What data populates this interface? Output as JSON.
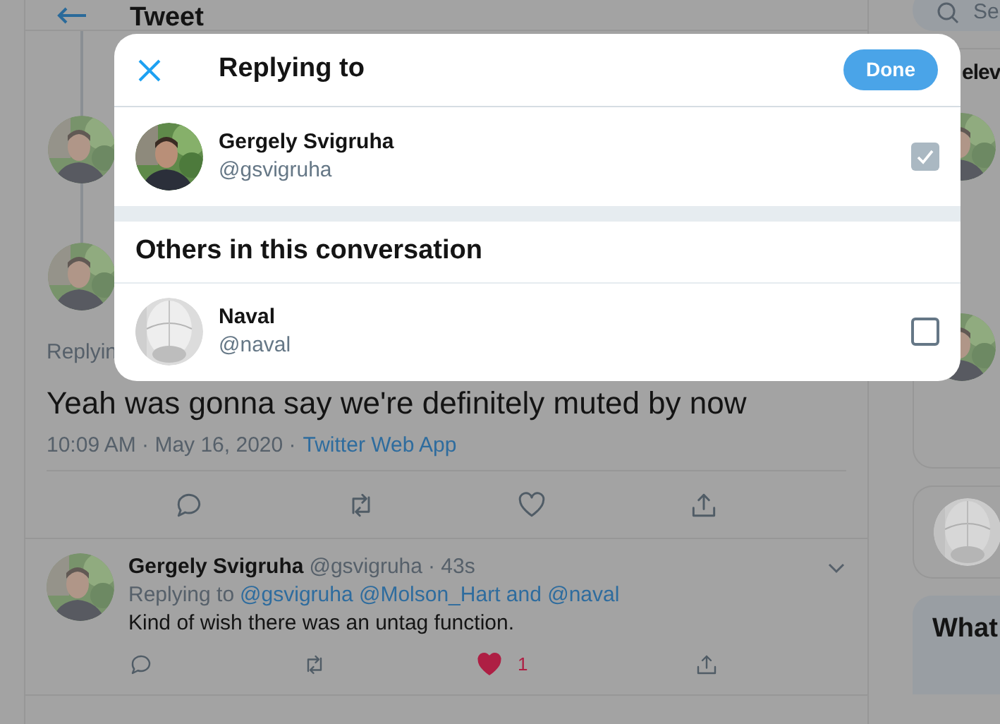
{
  "header": {
    "title": "Tweet"
  },
  "search": {
    "placeholder": "Se"
  },
  "thread": {
    "replying_label": "Replyin",
    "text": "Yeah was gonna say we're definitely muted by now",
    "time": "10:09 AM · May 16, 2020 ·",
    "source": "Twitter Web App"
  },
  "reply": {
    "name": "Gergely Svigruha",
    "handle": "@gsvigruha",
    "age": "· 43s",
    "replying_prefix": "Replying to",
    "mentions": "@gsvigruha @Molson_Hart and @naval",
    "text": "Kind of wish there was an untag function.",
    "likes": "1",
    "liked": true
  },
  "sidebar": {
    "heading": "elev",
    "what": "What"
  },
  "modal": {
    "title": "Replying to",
    "done": "Done",
    "author": {
      "name": "Gergely Svigruha",
      "handle": "@gsvigruha",
      "checked": true
    },
    "section": "Others in this conversation",
    "others": [
      {
        "name": "Naval",
        "handle": "@naval",
        "checked": false,
        "kind": "sketch"
      }
    ]
  }
}
